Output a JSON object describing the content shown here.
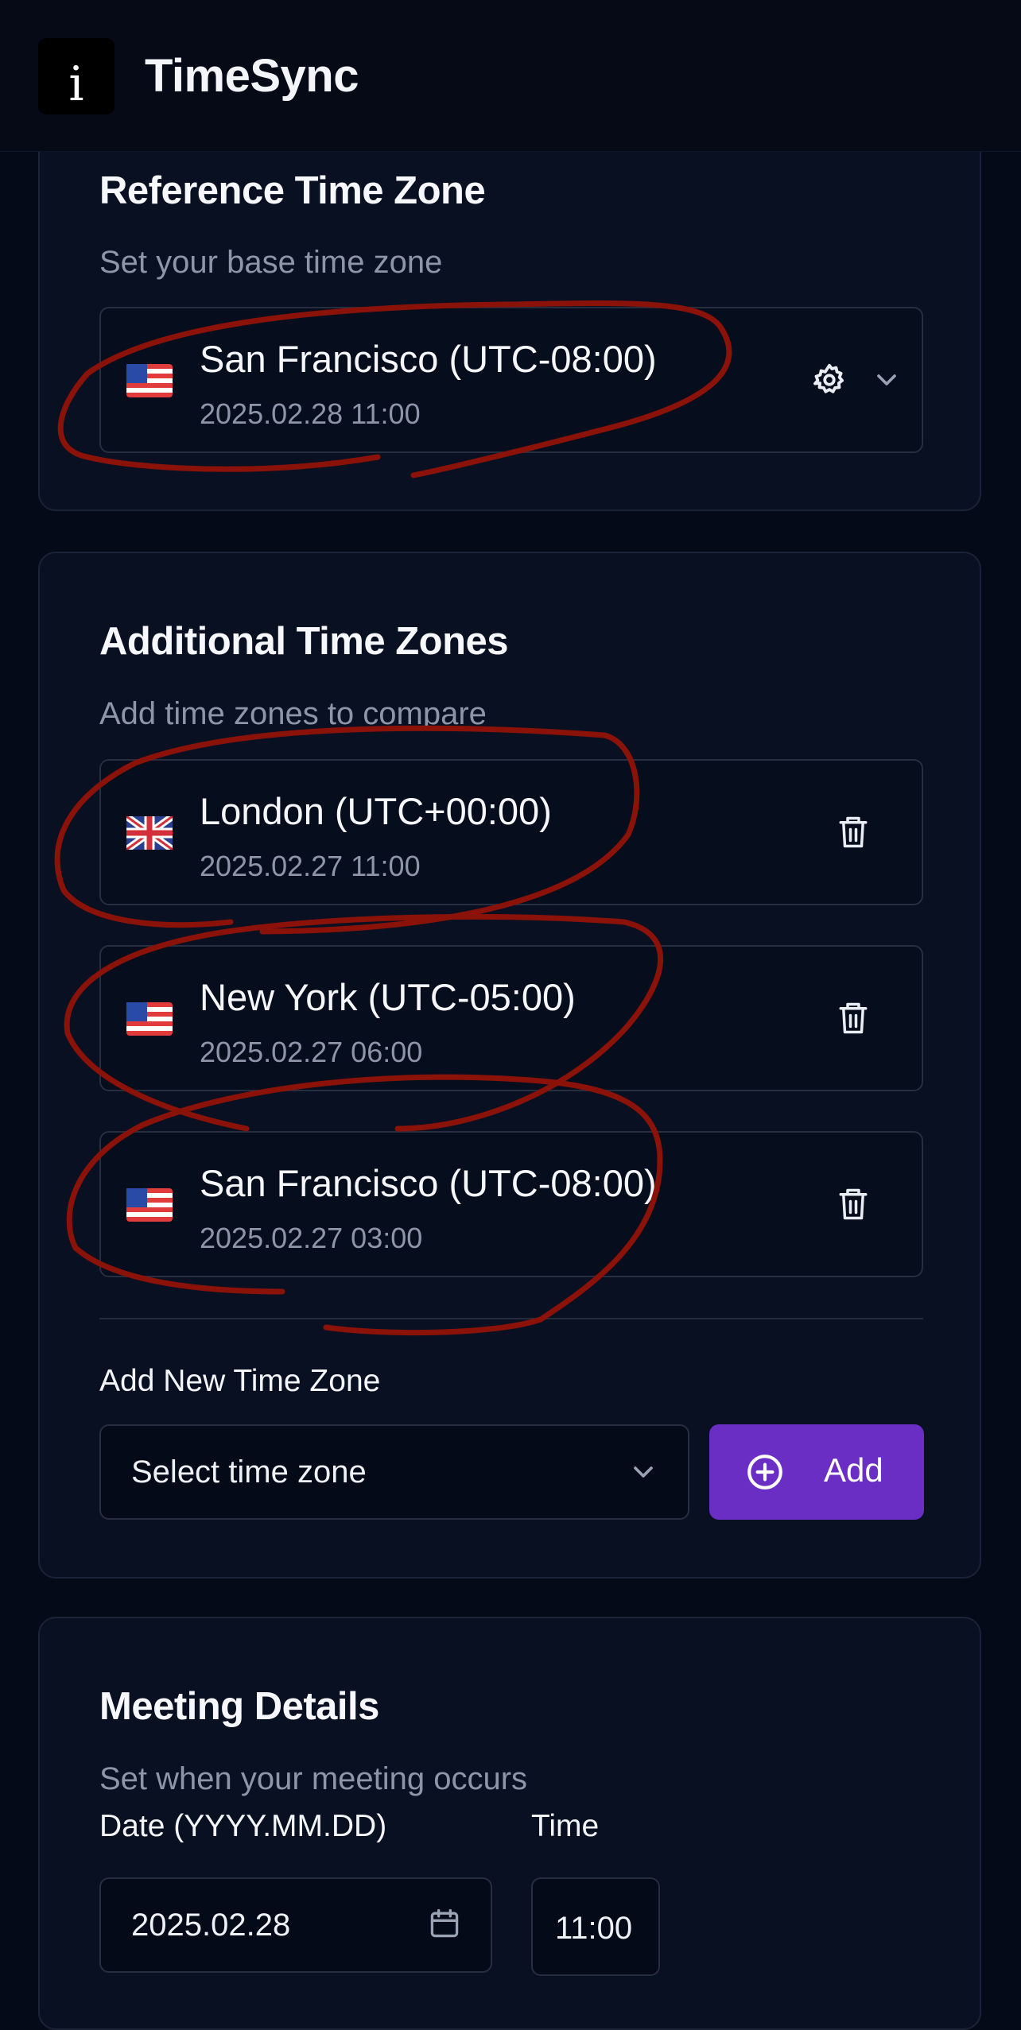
{
  "app": {
    "logo_glyph": "i",
    "title": "TimeSync"
  },
  "reference": {
    "title": "Reference Time Zone",
    "subtitle": "Set your base time zone",
    "zone": {
      "flag": "us-flag-icon",
      "name": "San Francisco (UTC-08:00)",
      "datetime": "2025.02.28 11:00"
    },
    "settings_icon": "gear-icon",
    "dropdown_icon": "chevron-down-icon"
  },
  "additional": {
    "title": "Additional Time Zones",
    "subtitle": "Add time zones to compare",
    "zones": [
      {
        "flag": "uk-flag-icon",
        "name": "London (UTC+00:00)",
        "datetime": "2025.02.27 11:00"
      },
      {
        "flag": "us-flag-icon",
        "name": "New York (UTC-05:00)",
        "datetime": "2025.02.27 06:00"
      },
      {
        "flag": "us-flag-icon",
        "name": "San Francisco (UTC-08:00)",
        "datetime": "2025.02.27 03:00"
      }
    ],
    "add_label": "Add New Time Zone",
    "select_placeholder": "Select time zone",
    "add_button": "Add"
  },
  "meeting": {
    "title": "Meeting Details",
    "subtitle": "Set when your meeting occurs",
    "date_label": "Date (YYYY.MM.DD)",
    "date_value": "2025.02.28",
    "time_label": "Time",
    "time_value": "11:00"
  },
  "colors": {
    "background": "#050a18",
    "card": "#081022",
    "accent": "#6a2ec4",
    "annotation": "#8b1208"
  }
}
